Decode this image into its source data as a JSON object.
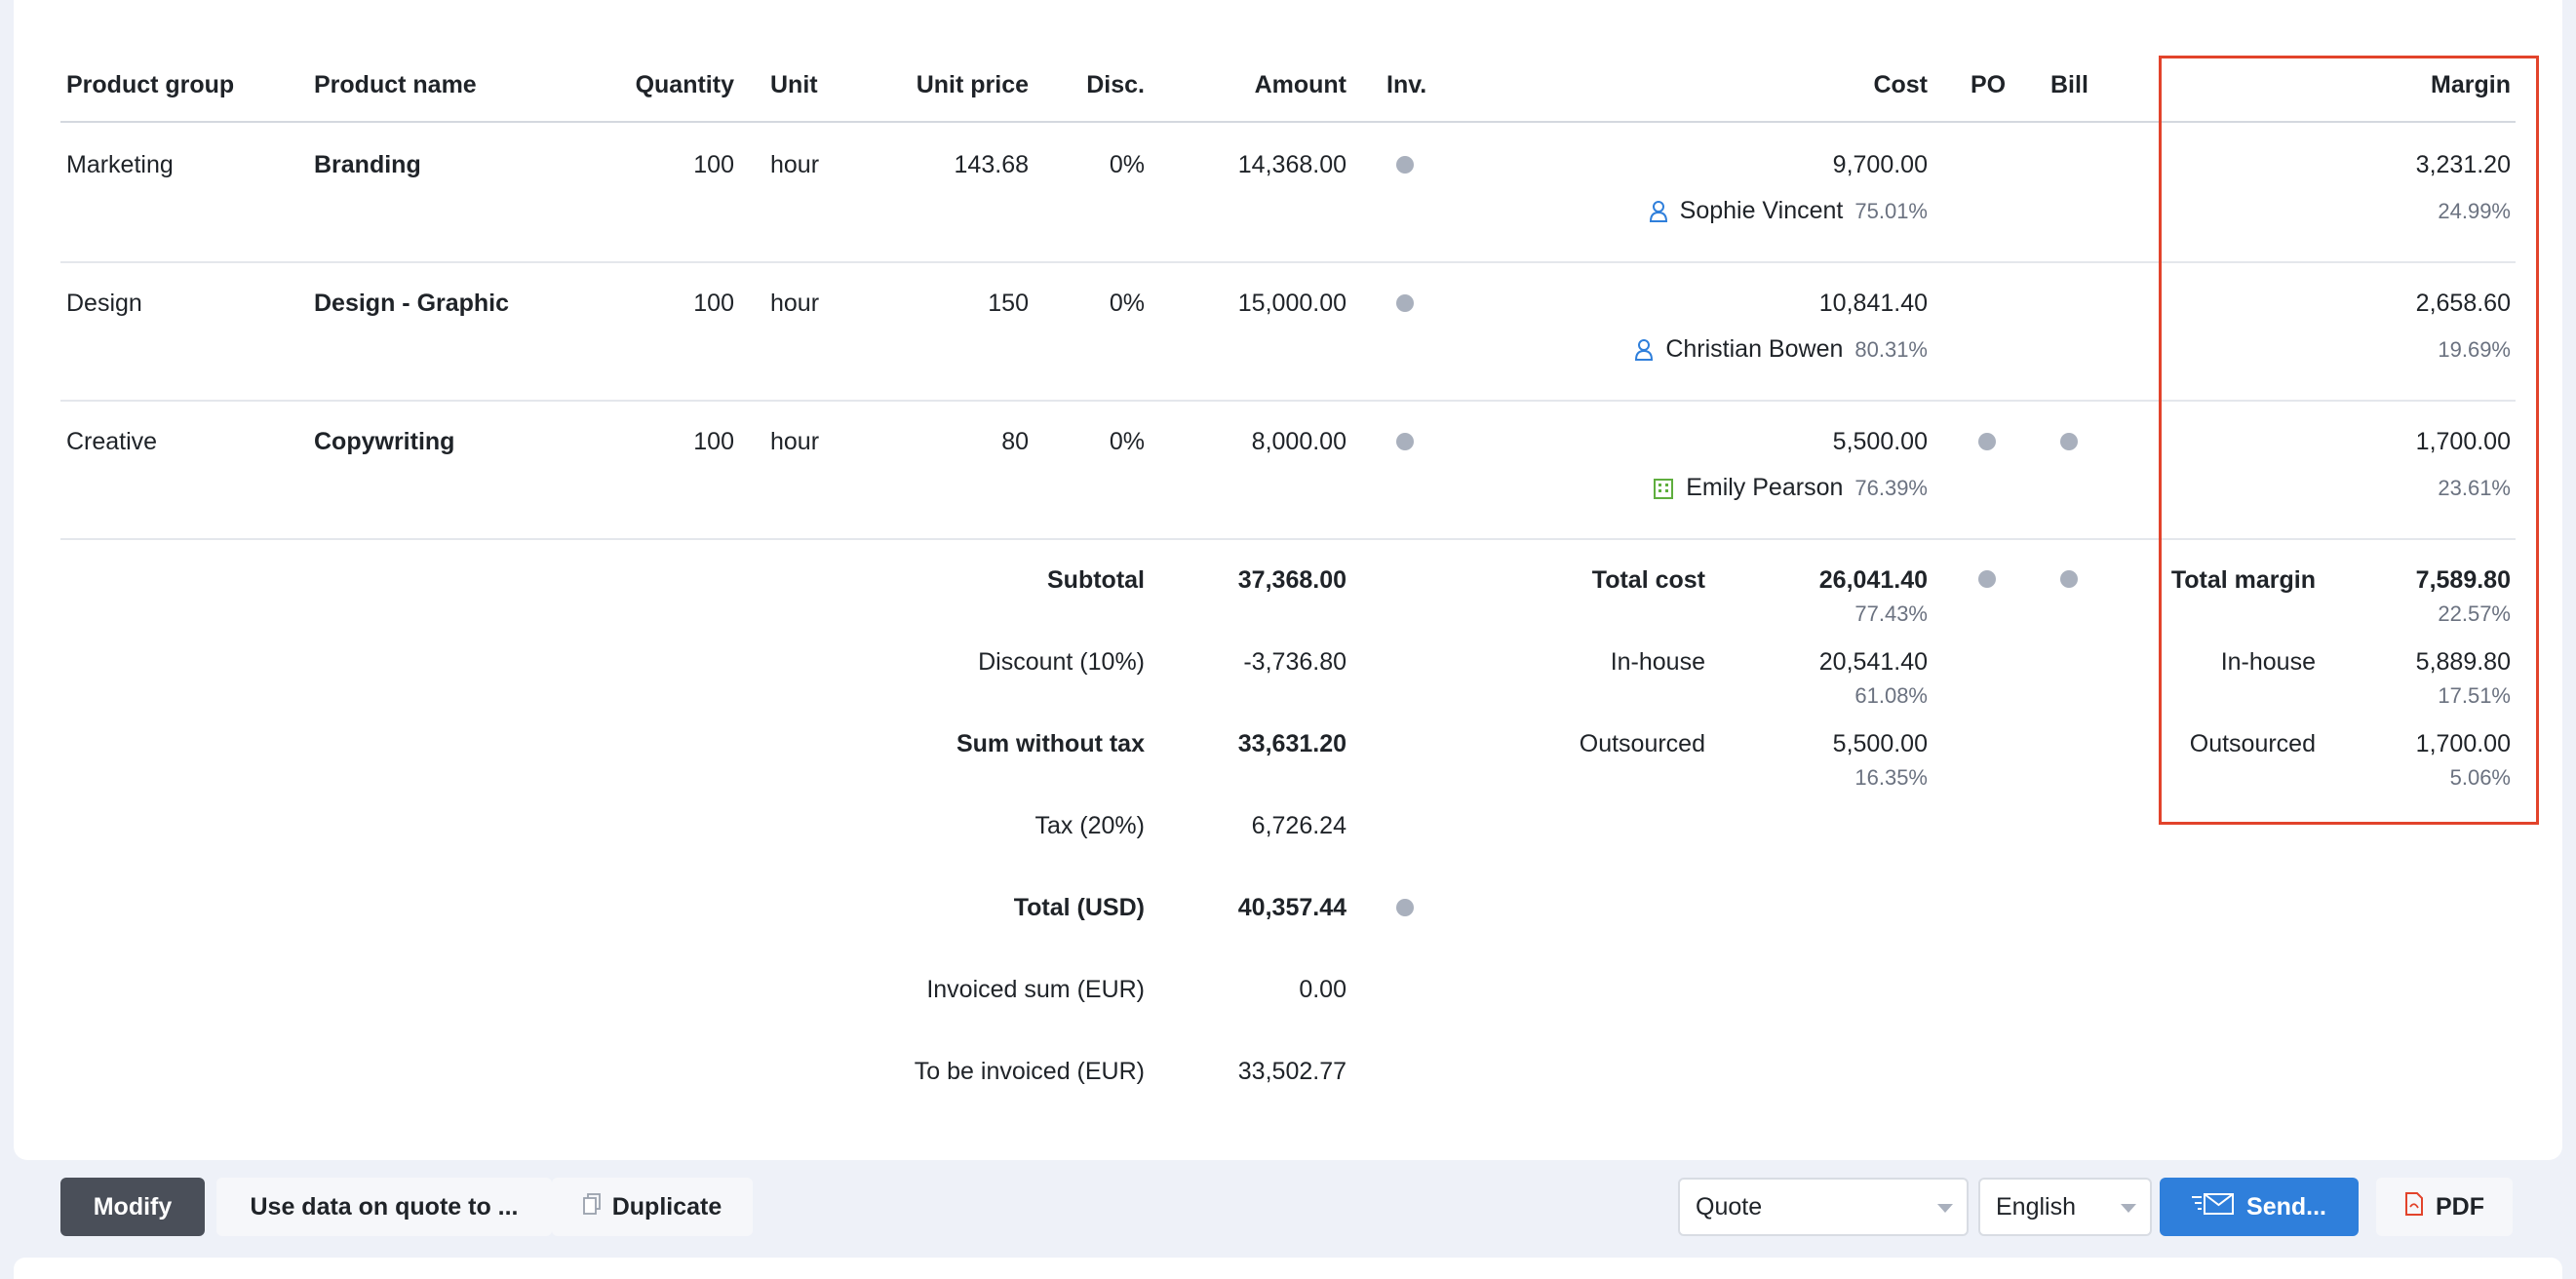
{
  "headers": {
    "product_group": "Product group",
    "product_name": "Product name",
    "quantity": "Quantity",
    "unit": "Unit",
    "unit_price": "Unit price",
    "disc": "Disc.",
    "amount": "Amount",
    "inv": "Inv.",
    "cost": "Cost",
    "po": "PO",
    "bill": "Bill",
    "margin": "Margin"
  },
  "rows": [
    {
      "group": "Marketing",
      "name": "Branding",
      "quantity": "100",
      "unit": "hour",
      "unit_price": "143.68",
      "disc": "0%",
      "amount": "14,368.00",
      "cost": "9,700.00",
      "person": "Sophie Vincent",
      "person_pct": "75.01%",
      "person_icon": "user-icon",
      "margin": "3,231.20",
      "margin_pct": "24.99%"
    },
    {
      "group": "Design",
      "name": "Design - Graphic",
      "quantity": "100",
      "unit": "hour",
      "unit_price": "150",
      "disc": "0%",
      "amount": "15,000.00",
      "cost": "10,841.40",
      "person": "Christian Bowen",
      "person_pct": "80.31%",
      "person_icon": "user-icon",
      "margin": "2,658.60",
      "margin_pct": "19.69%"
    },
    {
      "group": "Creative",
      "name": "Copywriting",
      "quantity": "100",
      "unit": "hour",
      "unit_price": "80",
      "disc": "0%",
      "amount": "8,000.00",
      "cost": "5,500.00",
      "person": "Emily Pearson",
      "person_pct": "76.39%",
      "person_icon": "building-icon",
      "margin": "1,700.00",
      "margin_pct": "23.61%"
    }
  ],
  "totals": {
    "subtotal_label": "Subtotal",
    "subtotal_value": "37,368.00",
    "discount_label": "Discount (10%)",
    "discount_value": "-3,736.80",
    "sum_wo_tax_label": "Sum without tax",
    "sum_wo_tax_value": "33,631.20",
    "tax_label": "Tax (20%)",
    "tax_value": "6,726.24",
    "total_label": "Total (USD)",
    "total_value": "40,357.44",
    "invoiced_label": "Invoiced sum (EUR)",
    "invoiced_value": "0.00",
    "to_invoice_label": "To be invoiced (EUR)",
    "to_invoice_value": "33,502.77"
  },
  "cost_summary": {
    "total_label": "Total cost",
    "total_value": "26,041.40",
    "total_pct": "77.43%",
    "inhouse_label": "In-house",
    "inhouse_value": "20,541.40",
    "inhouse_pct": "61.08%",
    "outsourced_label": "Outsourced",
    "outsourced_value": "5,500.00",
    "outsourced_pct": "16.35%"
  },
  "margin_summary": {
    "total_label": "Total margin",
    "total_value": "7,589.80",
    "total_pct": "22.57%",
    "inhouse_label": "In-house",
    "inhouse_value": "5,889.80",
    "inhouse_pct": "17.51%",
    "outsourced_label": "Outsourced",
    "outsourced_value": "1,700.00",
    "outsourced_pct": "5.06%"
  },
  "toolbar": {
    "modify_label": "Modify",
    "use_data_label": "Use data on quote to ...",
    "duplicate_label": "Duplicate",
    "doc_type_value": "Quote",
    "language_value": "English",
    "send_label": "Send...",
    "pdf_label": "PDF"
  },
  "colors": {
    "highlight": "#e2432b",
    "send_button": "#2f7fdb",
    "modify_button": "#4a4f59",
    "status_dot": "#a9b0bd"
  }
}
